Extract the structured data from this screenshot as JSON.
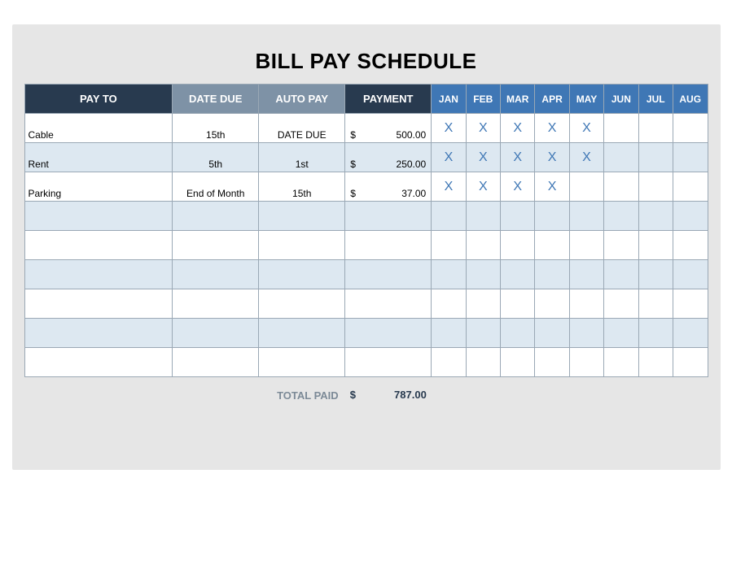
{
  "title": "BILL PAY SCHEDULE",
  "headers": {
    "pay_to": "PAY TO",
    "date_due": "DATE DUE",
    "auto_pay": "AUTO PAY",
    "payment": "PAYMENT"
  },
  "months": [
    "JAN",
    "FEB",
    "MAR",
    "APR",
    "MAY",
    "JUN",
    "JUL",
    "AUG"
  ],
  "currency": "$",
  "mark": "X",
  "rows": [
    {
      "pay_to": "Cable",
      "date_due": "15th",
      "auto_pay": "DATE DUE",
      "payment": "500.00",
      "months": [
        "X",
        "X",
        "X",
        "X",
        "X",
        "",
        "",
        ""
      ]
    },
    {
      "pay_to": "Rent",
      "date_due": "5th",
      "auto_pay": "1st",
      "payment": "250.00",
      "months": [
        "X",
        "X",
        "X",
        "X",
        "X",
        "",
        "",
        ""
      ]
    },
    {
      "pay_to": "Parking",
      "date_due": "End of Month",
      "auto_pay": "15th",
      "payment": "37.00",
      "months": [
        "X",
        "X",
        "X",
        "X",
        "",
        "",
        "",
        ""
      ]
    },
    {
      "pay_to": "",
      "date_due": "",
      "auto_pay": "",
      "payment": "",
      "months": [
        "",
        "",
        "",
        "",
        "",
        "",
        "",
        ""
      ]
    },
    {
      "pay_to": "",
      "date_due": "",
      "auto_pay": "",
      "payment": "",
      "months": [
        "",
        "",
        "",
        "",
        "",
        "",
        "",
        ""
      ]
    },
    {
      "pay_to": "",
      "date_due": "",
      "auto_pay": "",
      "payment": "",
      "months": [
        "",
        "",
        "",
        "",
        "",
        "",
        "",
        ""
      ]
    },
    {
      "pay_to": "",
      "date_due": "",
      "auto_pay": "",
      "payment": "",
      "months": [
        "",
        "",
        "",
        "",
        "",
        "",
        "",
        ""
      ]
    },
    {
      "pay_to": "",
      "date_due": "",
      "auto_pay": "",
      "payment": "",
      "months": [
        "",
        "",
        "",
        "",
        "",
        "",
        "",
        ""
      ]
    },
    {
      "pay_to": "",
      "date_due": "",
      "auto_pay": "",
      "payment": "",
      "months": [
        "",
        "",
        "",
        "",
        "",
        "",
        "",
        ""
      ]
    }
  ],
  "total": {
    "label": "TOTAL PAID",
    "value": "787.00"
  }
}
